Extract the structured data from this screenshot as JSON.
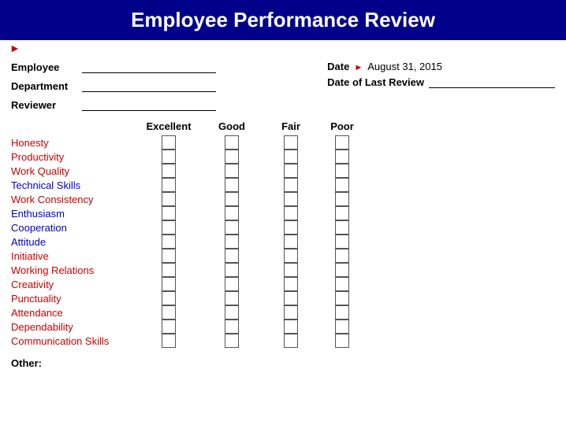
{
  "header": {
    "title": "Employee Performance Review"
  },
  "form": {
    "employee_label": "Employee",
    "department_label": "Department",
    "reviewer_label": "Reviewer",
    "date_label": "Date",
    "date_value": "August 31, 2015",
    "date_last_review_label": "Date of Last Review"
  },
  "rating_headers": {
    "excellent": "Excellent",
    "good": "Good",
    "fair": "Fair",
    "poor": "Poor"
  },
  "criteria": [
    {
      "label": "Honesty",
      "color": "red"
    },
    {
      "label": "Productivity",
      "color": "red"
    },
    {
      "label": "Work Quality",
      "color": "red"
    },
    {
      "label": "Technical Skills",
      "color": "blue"
    },
    {
      "label": "Work Consistency",
      "color": "red"
    },
    {
      "label": "Enthusiasm",
      "color": "blue"
    },
    {
      "label": "Cooperation",
      "color": "blue"
    },
    {
      "label": "Attitude",
      "color": "blue"
    },
    {
      "label": "Initiative",
      "color": "red"
    },
    {
      "label": "Working Relations",
      "color": "red"
    },
    {
      "label": "Creativity",
      "color": "red"
    },
    {
      "label": "Punctuality",
      "color": "red"
    },
    {
      "label": "Attendance",
      "color": "red"
    },
    {
      "label": "Dependability",
      "color": "red"
    },
    {
      "label": "Communication Skills",
      "color": "red"
    }
  ],
  "other_label": "Other:"
}
